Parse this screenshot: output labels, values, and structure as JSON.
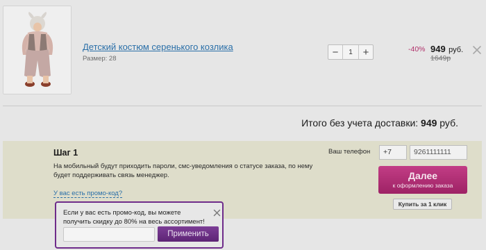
{
  "product": {
    "name": "Детский костюм серенького козлика",
    "size": "Размер: 28",
    "quantity": "1",
    "discount": "-40%",
    "price": "949",
    "currency": "руб.",
    "old_price": "1649р",
    "qty_minus": "−",
    "qty_plus": "+"
  },
  "total": {
    "label": "Итого без учета доставки:",
    "amount": "949",
    "currency": "руб."
  },
  "step": {
    "title": "Шаг 1",
    "description": "На мобильный будут приходить пароли, смс-уведомления о статусе заказа, по нему будет поддерживать связь менеджер.",
    "promo_link": "У вас есть промо-код?",
    "phone_label": "Ваш телефон",
    "phone_code": "+7",
    "phone_number": "9261111111",
    "next_label": "Далее",
    "next_sub": "к оформлению заказа",
    "one_click": "Купить за 1 клик"
  },
  "promo_popup": {
    "text": "Если у вас есть промо-код, вы можете получить скидку до 80% на весь ассортимент!",
    "input_value": "",
    "apply_label": "Применить"
  },
  "colors": {
    "accent_pink": "#b0306a",
    "link_blue": "#2a6fa8",
    "popup_purple": "#6e2b8a"
  }
}
